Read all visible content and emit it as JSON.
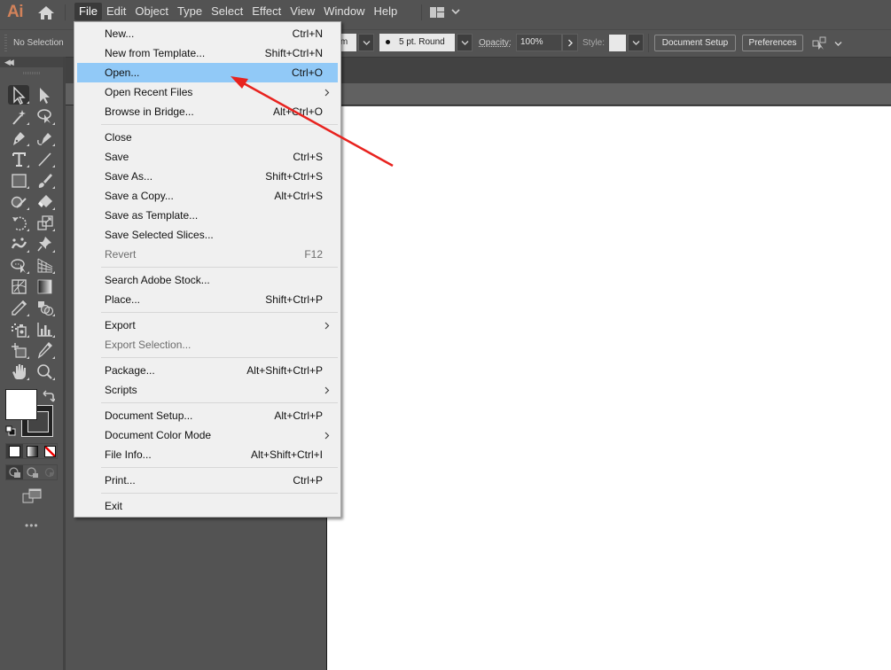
{
  "app": {
    "logo_text": "Ai",
    "accent_color": "#d2825a"
  },
  "menubar": {
    "items": [
      "File",
      "Edit",
      "Object",
      "Type",
      "Select",
      "Effect",
      "View",
      "Window",
      "Help"
    ],
    "active_item": "File"
  },
  "controlbar": {
    "selection_status": "No Selection",
    "brush_definition_partial": "orm",
    "stroke_profile": "5 pt. Round",
    "opacity_label": "Opacity:",
    "opacity_value": "100%",
    "style_label": "Style:",
    "document_setup_label": "Document Setup",
    "preferences_label": "Preferences"
  },
  "file_menu": {
    "groups": [
      [
        {
          "label": "New...",
          "shortcut": "Ctrl+N"
        },
        {
          "label": "New from Template...",
          "shortcut": "Shift+Ctrl+N"
        },
        {
          "label": "Open...",
          "shortcut": "Ctrl+O",
          "highlighted": true
        },
        {
          "label": "Open Recent Files",
          "submenu": true
        },
        {
          "label": "Browse in Bridge...",
          "shortcut": "Alt+Ctrl+O"
        }
      ],
      [
        {
          "label": "Close",
          "shortcut": ""
        },
        {
          "label": "Save",
          "shortcut": "Ctrl+S"
        },
        {
          "label": "Save As...",
          "shortcut": "Shift+Ctrl+S"
        },
        {
          "label": "Save a Copy...",
          "shortcut": "Alt+Ctrl+S"
        },
        {
          "label": "Save as Template...",
          "shortcut": ""
        },
        {
          "label": "Save Selected Slices...",
          "shortcut": ""
        },
        {
          "label": "Revert",
          "shortcut": "F12",
          "disabled": true
        }
      ],
      [
        {
          "label": "Search Adobe Stock...",
          "shortcut": ""
        },
        {
          "label": "Place...",
          "shortcut": "Shift+Ctrl+P"
        }
      ],
      [
        {
          "label": "Export",
          "submenu": true
        },
        {
          "label": "Export Selection...",
          "shortcut": "",
          "disabled": true
        }
      ],
      [
        {
          "label": "Package...",
          "shortcut": "Alt+Shift+Ctrl+P"
        },
        {
          "label": "Scripts",
          "submenu": true
        }
      ],
      [
        {
          "label": "Document Setup...",
          "shortcut": "Alt+Ctrl+P"
        },
        {
          "label": "Document Color Mode",
          "submenu": true
        },
        {
          "label": "File Info...",
          "shortcut": "Alt+Shift+Ctrl+I"
        }
      ],
      [
        {
          "label": "Print...",
          "shortcut": "Ctrl+P"
        }
      ],
      [
        {
          "label": "Exit",
          "shortcut": ""
        }
      ]
    ]
  },
  "toolbar": {
    "tools": [
      "selection-tool",
      "direct-selection-tool",
      "magic-wand-tool",
      "lasso-tool",
      "pen-tool",
      "curvature-tool",
      "type-tool",
      "line-segment-tool",
      "rectangle-tool",
      "paintbrush-tool",
      "shaper-tool",
      "eraser-tool",
      "rotate-tool",
      "scale-tool",
      "puppet-warp-tool",
      "pin-tool",
      "shape-builder-tool",
      "perspective-grid-tool",
      "mesh-tool",
      "gradient-tool",
      "eyedropper-tool",
      "blend-tool",
      "symbol-sprayer-tool",
      "column-graph-tool",
      "artboard-tool",
      "slice-tool",
      "hand-tool",
      "zoom-tool"
    ],
    "selected_tool": "selection-tool",
    "fill_color": "#ffffff",
    "stroke_color": "#222222",
    "more_label": "•••"
  },
  "annotation": {
    "color": "#e8231f",
    "points_to": "Open..."
  }
}
